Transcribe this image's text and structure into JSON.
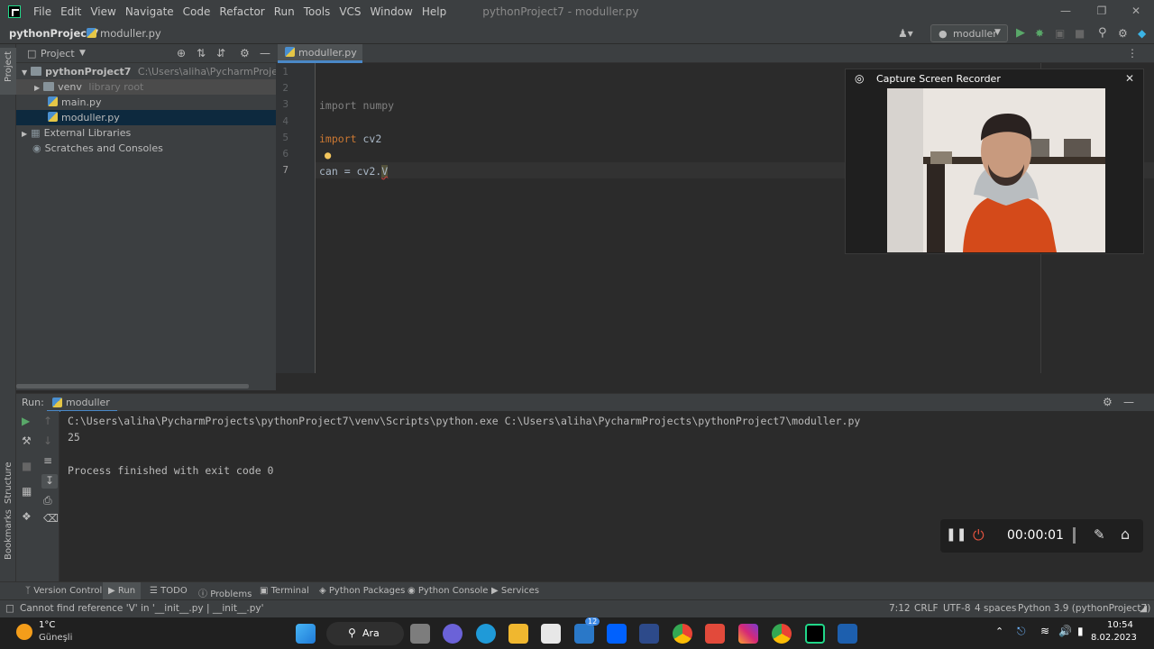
{
  "window": {
    "menu": [
      "File",
      "Edit",
      "View",
      "Navigate",
      "Code",
      "Refactor",
      "Run",
      "Tools",
      "VCS",
      "Window",
      "Help"
    ],
    "title": "pythonProject7 - moduller.py"
  },
  "navbar": {
    "project": "pythonProject7",
    "file": "moduller.py",
    "run_config": "moduller"
  },
  "project_panel": {
    "header": "Project",
    "side_tab": "Project",
    "tree": [
      {
        "label": "pythonProject7",
        "hint": "C:\\Users\\aliha\\PycharmProjects\\pythonP"
      },
      {
        "label": "venv",
        "hint": "library root"
      },
      {
        "label": "main.py"
      },
      {
        "label": "moduller.py"
      },
      {
        "label": "External Libraries"
      },
      {
        "label": "Scratches and Consoles"
      }
    ]
  },
  "editor": {
    "tab": "moduller.py",
    "line_numbers": [
      "1",
      "2",
      "3",
      "4",
      "5",
      "6",
      "7"
    ],
    "line3_kw": "import",
    "line3_rest": " numpy",
    "line5_kw": "import",
    "line5_rest": " cv2",
    "line7_text": "can = cv2.",
    "line7_err": "V"
  },
  "recorder": {
    "title": "Capture Screen Recorder",
    "timer": "00:00:01"
  },
  "run_panel": {
    "label": "Run:",
    "tab": "moduller",
    "output": [
      "C:\\Users\\aliha\\PycharmProjects\\pythonProject7\\venv\\Scripts\\python.exe C:\\Users\\aliha\\PycharmProjects\\pythonProject7\\moduller.py",
      "25",
      "",
      "Process finished with exit code 0"
    ],
    "side_tabs": [
      "Structure",
      "Bookmarks"
    ]
  },
  "tool_windows": [
    "Version Control",
    "Run",
    "TODO",
    "Problems",
    "Terminal",
    "Python Packages",
    "Python Console",
    "Services"
  ],
  "status": {
    "message": "Cannot find reference 'V' in '__init__.py | __init__.py'",
    "position": "7:12",
    "line_sep": "CRLF",
    "encoding": "UTF-8",
    "indent": "4 spaces",
    "interpreter": "Python 3.9 (pythonProject7)"
  },
  "taskbar": {
    "weather_temp": "1°C",
    "weather_desc": "Güneşli",
    "search": "Ara",
    "badge": "12",
    "time": "10:54",
    "date": "8.02.2023"
  },
  "colors": {
    "accent": "#4a88c7",
    "keyword": "#cc7832",
    "run_green": "#59a869"
  }
}
